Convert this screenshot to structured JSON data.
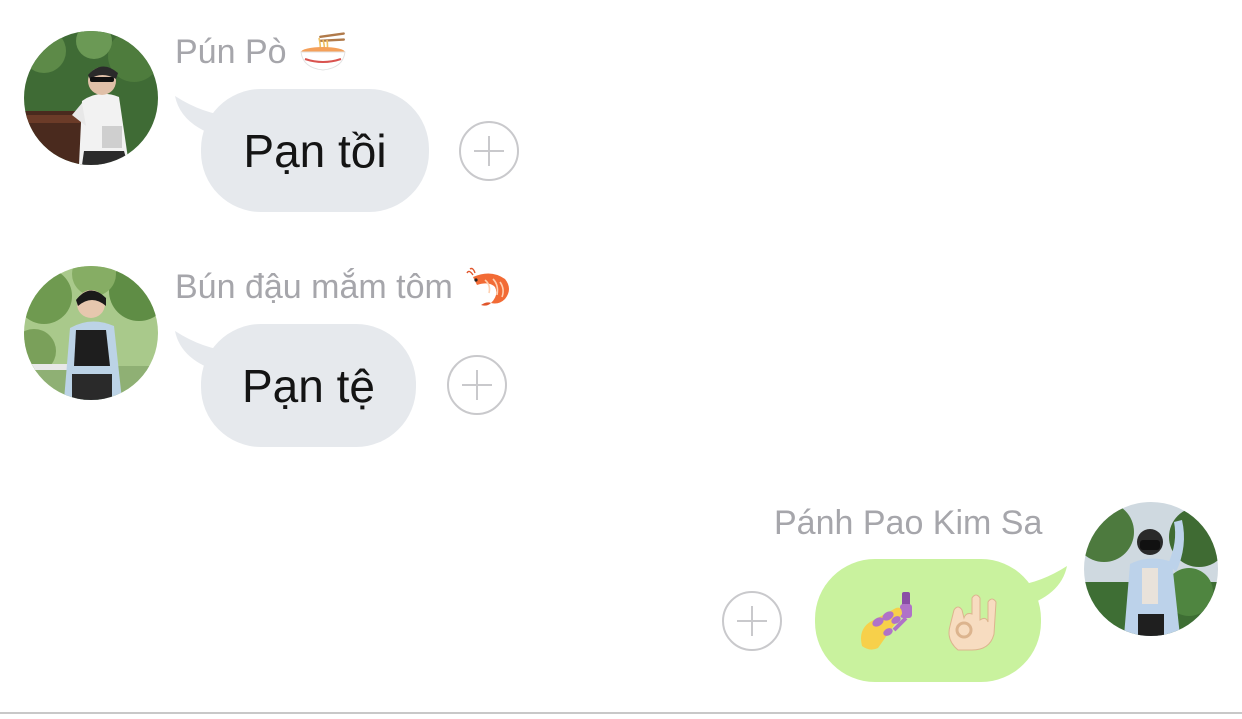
{
  "messages": [
    {
      "sender": "Pún Pò",
      "sender_emoji": "noodle-bowl-icon",
      "text": "Pạn tồi",
      "direction": "incoming"
    },
    {
      "sender": "Bún đậu mắm tôm",
      "sender_emoji": "shrimp-icon",
      "text": "Pạn tệ",
      "direction": "incoming"
    },
    {
      "sender": "Pánh Pao Kim Sa",
      "sender_emoji": "",
      "emojis": [
        "nail-polish-icon",
        "ok-hand-icon"
      ],
      "direction": "outgoing"
    }
  ],
  "colors": {
    "incoming_bubble": "#e6e9ed",
    "outgoing_bubble": "#c9f29e",
    "sender_name": "#a6a6ab",
    "reaction_outline": "#c9c9cc"
  }
}
